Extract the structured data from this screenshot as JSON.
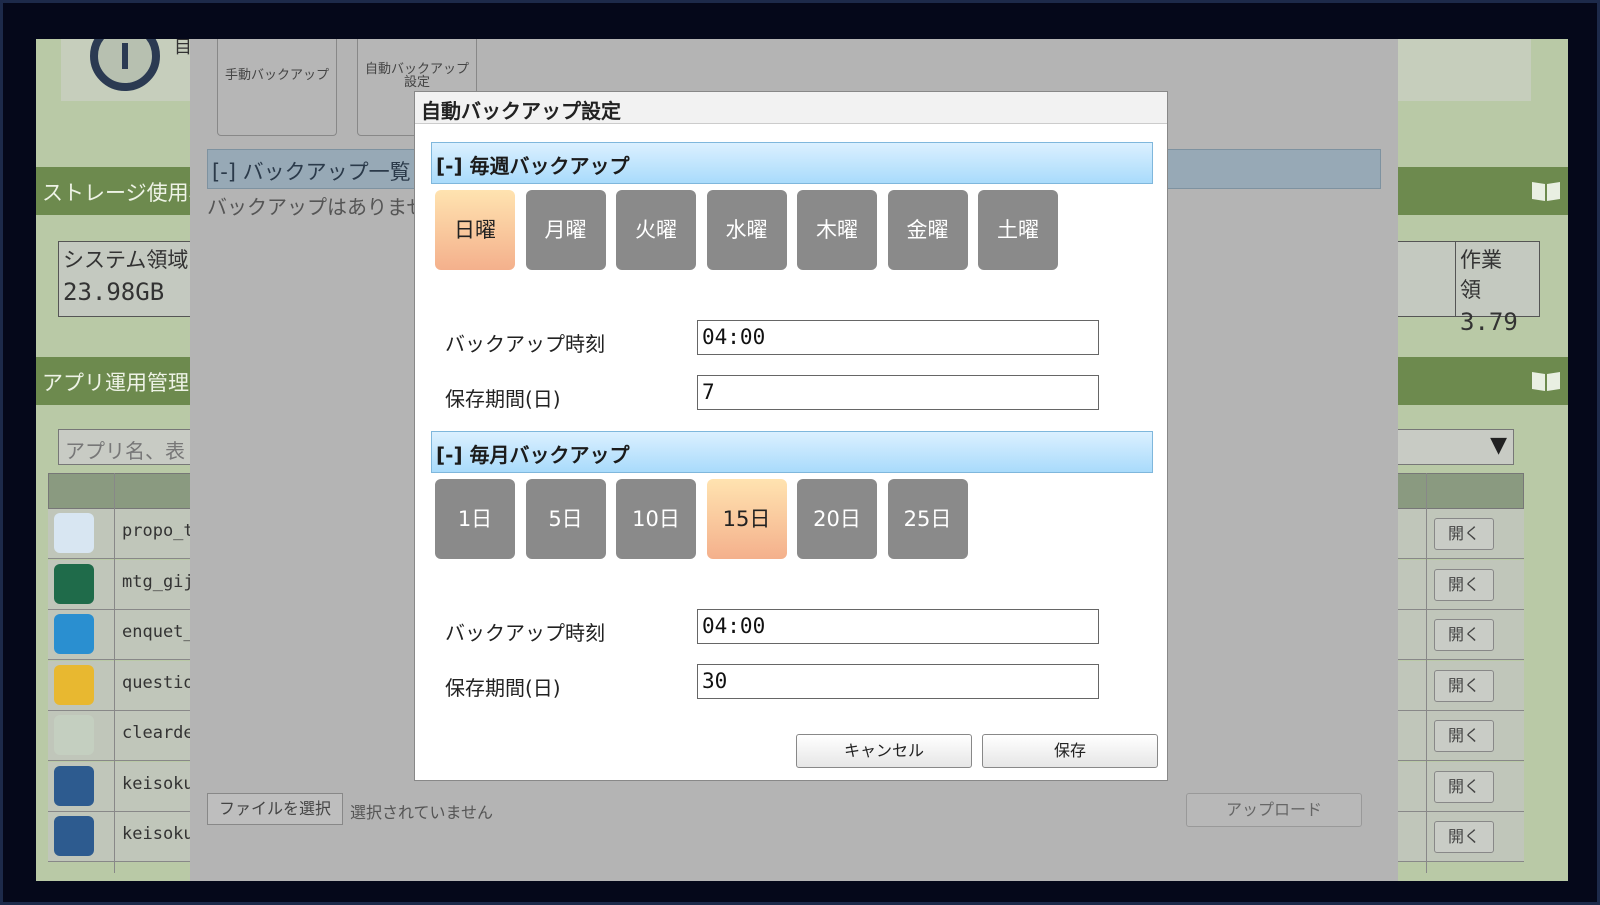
{
  "background": {
    "header_label": "目",
    "storage_section_title": "ストレージ使用状",
    "storage": {
      "left_label": "システム領域",
      "left_value": "23.98GB",
      "right_label": "作業領",
      "right_value": "3.79"
    },
    "apps_section_title": "アプリ運用管理",
    "search_placeholder": "アプリ名、表",
    "search_arrow": "▼",
    "apps": [
      {
        "name": "propo_tr",
        "icon": "person-icon",
        "open_label": "開く"
      },
      {
        "name": "mtg_giji",
        "icon": "notebook-icon",
        "open_label": "開く"
      },
      {
        "name": "enquet_s",
        "icon": "edit-icon",
        "open_label": "開く"
      },
      {
        "name": "question",
        "icon": "box-icon",
        "open_label": "開く"
      },
      {
        "name": "cleardes",
        "icon": "desk-icon",
        "open_label": "開く"
      },
      {
        "name": "keisoku_",
        "icon": "ruler-icon",
        "open_label": "開く"
      },
      {
        "name": "keisoku_",
        "icon": "ruler-icon",
        "open_label": "開く"
      }
    ],
    "backup_panel": {
      "tab_manual": "手動バックアップ",
      "tab_auto_line1": "自動バックアップ",
      "tab_auto_line2": "設定",
      "list_title": "[-] バックアップ一覧",
      "no_items": "バックアップはありませ",
      "file_button": "ファイルを選択",
      "file_status": "選択されていません",
      "upload_button": "アップロード"
    }
  },
  "modal": {
    "title": "自動バックアップ設定",
    "weekly": {
      "section_title": "[-] 毎週バックアップ",
      "days": [
        {
          "label": "日曜",
          "active": true
        },
        {
          "label": "月曜",
          "active": false
        },
        {
          "label": "火曜",
          "active": false
        },
        {
          "label": "水曜",
          "active": false
        },
        {
          "label": "木曜",
          "active": false
        },
        {
          "label": "金曜",
          "active": false
        },
        {
          "label": "土曜",
          "active": false
        }
      ],
      "time_label": "バックアップ時刻",
      "time_value": "04:00",
      "retention_label": "保存期間(日)",
      "retention_value": "7"
    },
    "monthly": {
      "section_title": "[-] 毎月バックアップ",
      "days": [
        {
          "label": "1日",
          "active": false
        },
        {
          "label": "5日",
          "active": false
        },
        {
          "label": "10日",
          "active": false
        },
        {
          "label": "15日",
          "active": true
        },
        {
          "label": "20日",
          "active": false
        },
        {
          "label": "25日",
          "active": false
        }
      ],
      "time_label": "バックアップ時刻",
      "time_value": "04:00",
      "retention_label": "保存期間(日)",
      "retention_value": "30"
    },
    "cancel_label": "キャンセル",
    "save_label": "保存"
  }
}
